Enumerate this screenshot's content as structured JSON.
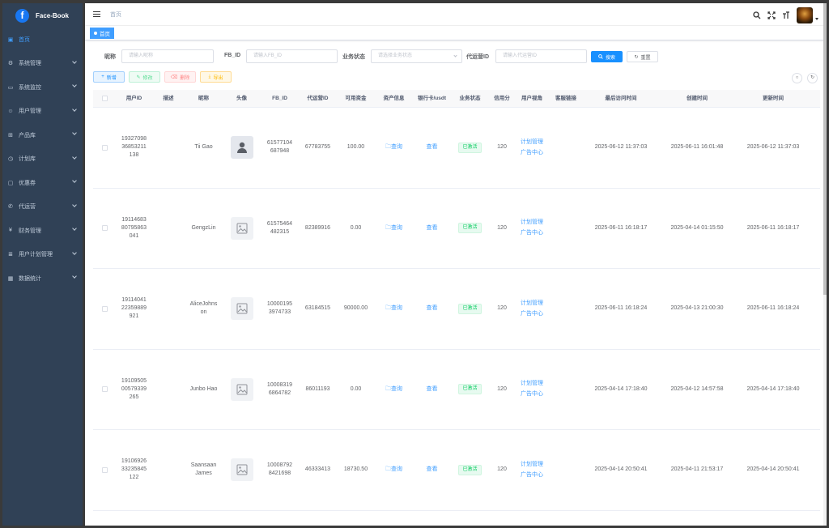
{
  "app": {
    "brand": "Face-Book",
    "logo_letter": "f"
  },
  "sidebar": {
    "items": [
      {
        "label": "首页",
        "icon": "dashboard-icon",
        "glyph": "▣",
        "active": true,
        "has_children": false
      },
      {
        "label": "系统管理",
        "icon": "gear-icon",
        "glyph": "⚙",
        "active": false,
        "has_children": true
      },
      {
        "label": "系统监控",
        "icon": "monitor-icon",
        "glyph": "▭",
        "active": false,
        "has_children": true
      },
      {
        "label": "用户管理",
        "icon": "user-icon",
        "glyph": "☺",
        "active": false,
        "has_children": true
      },
      {
        "label": "产品库",
        "icon": "cart-icon",
        "glyph": "⊞",
        "active": false,
        "has_children": true
      },
      {
        "label": "计划库",
        "icon": "clock-icon",
        "glyph": "◷",
        "active": false,
        "has_children": true
      },
      {
        "label": "优惠券",
        "icon": "ticket-icon",
        "glyph": "▢",
        "active": false,
        "has_children": true
      },
      {
        "label": "代运营",
        "icon": "phone-icon",
        "glyph": "✆",
        "active": false,
        "has_children": true
      },
      {
        "label": "财务管理",
        "icon": "yen-icon",
        "glyph": "¥",
        "active": false,
        "has_children": true
      },
      {
        "label": "用户计划管理",
        "icon": "list-icon",
        "glyph": "≣",
        "active": false,
        "has_children": true
      },
      {
        "label": "数据统计",
        "icon": "chart-icon",
        "glyph": "▦",
        "active": false,
        "has_children": true
      }
    ]
  },
  "navbar": {
    "breadcrumb": "首页"
  },
  "tags": {
    "active_tag": "首页"
  },
  "search": {
    "nickname_label": "昵称",
    "nickname_placeholder": "请输入昵称",
    "fbid_label": "FB_ID",
    "fbid_placeholder": "请输入FB_ID",
    "status_label": "业务状态",
    "status_placeholder": "请选择业务状态",
    "agent_label": "代运营ID",
    "agent_placeholder": "请输入代运营ID",
    "search_btn": "搜索",
    "reset_btn": "重置"
  },
  "toolbar": {
    "add": "新增",
    "edit": "修改",
    "delete": "删除",
    "export": "导出"
  },
  "table": {
    "headers": {
      "uid": "用户ID",
      "desc": "描述",
      "nickname": "昵称",
      "avatar": "头像",
      "fbid": "FB_ID",
      "agent": "代运营ID",
      "funds": "可用资金",
      "asset": "资产信息",
      "bank": "银行卡/usdt",
      "status": "业务状态",
      "credit": "信用分",
      "view": "用户视角",
      "service": "客服链接",
      "last_visit": "最后访问时间",
      "created": "创建时间",
      "updated": "更新时间"
    },
    "rows": [
      {
        "uid": "1932709836853211138",
        "desc": "",
        "nickname": "Tii Gao",
        "avatar_type": "person",
        "fbid": "61577104687948",
        "agent": "67783755",
        "funds": "100.00",
        "asset": "查询",
        "bank": "查看",
        "status": "已激活",
        "credit": "120",
        "plan": "计划管理",
        "ad": "广告中心",
        "last_visit": "2025-06-12 11:37:03",
        "created": "2025-06-11 16:01:48",
        "updated": "2025-06-12 11:37:03"
      },
      {
        "uid": "1911468380795863041",
        "desc": "",
        "nickname": "GengzLin",
        "avatar_type": "image",
        "fbid": "61575464482315",
        "agent": "82389916",
        "funds": "0.00",
        "asset": "查询",
        "bank": "查看",
        "status": "已激活",
        "credit": "120",
        "plan": "计划管理",
        "ad": "广告中心",
        "last_visit": "2025-06-11 16:18:17",
        "created": "2025-04-14 01:15:50",
        "updated": "2025-06-11 16:18:17"
      },
      {
        "uid": "1911404122359889921",
        "desc": "",
        "nickname": "AliceJohnson",
        "avatar_type": "image",
        "fbid": "100001953974733",
        "agent": "63184515",
        "funds": "90000.00",
        "asset": "查询",
        "bank": "查看",
        "status": "已激活",
        "credit": "120",
        "plan": "计划管理",
        "ad": "广告中心",
        "last_visit": "2025-06-11 16:18:24",
        "created": "2025-04-13 21:00:30",
        "updated": "2025-06-11 16:18:24"
      },
      {
        "uid": "1910950500579339265",
        "desc": "",
        "nickname": "Junbo Hao",
        "avatar_type": "image",
        "fbid": "100083196864782",
        "agent": "86011193",
        "funds": "0.00",
        "asset": "查询",
        "bank": "查看",
        "status": "已激活",
        "credit": "120",
        "plan": "计划管理",
        "ad": "广告中心",
        "last_visit": "2025-04-14 17:18:40",
        "created": "2025-04-12 14:57:58",
        "updated": "2025-04-14 17:18:40"
      },
      {
        "uid": "1910692633235845122",
        "desc": "",
        "nickname": "Saansaan James",
        "avatar_type": "image",
        "fbid": "100087928421698",
        "agent": "46333413",
        "funds": "18730.50",
        "asset": "查询",
        "bank": "查看",
        "status": "已激活",
        "credit": "120",
        "plan": "计划管理",
        "ad": "广告中心",
        "last_visit": "2025-04-14 20:50:41",
        "created": "2025-04-11 21:53:17",
        "updated": "2025-04-14 20:50:41"
      }
    ]
  },
  "colors": {
    "sidebar_bg": "#304156",
    "primary": "#409eff",
    "success": "#13ce66"
  }
}
